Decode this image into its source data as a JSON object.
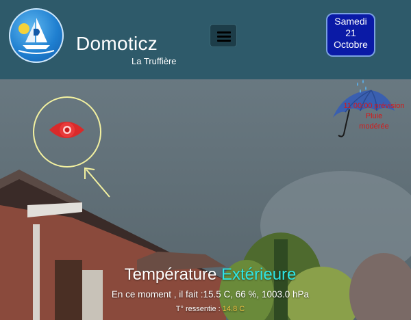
{
  "header": {
    "title": "Domoticz",
    "subtitle": "La Truffière",
    "date": {
      "day_name": "Samedi",
      "day_number": "21",
      "month": "Octobre"
    },
    "colors": {
      "bar": "#2e5a6a",
      "date_box": "#0a1aa6"
    }
  },
  "widgets": {
    "eye_icon": "eye-icon",
    "weather": {
      "icon": "umbrella-rain-icon",
      "line1": "11 00:00 prévision",
      "line2": "Pluie",
      "line3": "modérée",
      "color": "#d61818"
    }
  },
  "temperature": {
    "title_prefix": "Température",
    "title_accent": "Extérieure",
    "now_text": "En ce moment , il fait :15.5 C, 66 %, 1003.0 hPa",
    "feel_label": "T° ressentie :",
    "feel_value": "14.8 C",
    "accent_color": "#2ee6e6",
    "feel_color": "#f5c542"
  }
}
